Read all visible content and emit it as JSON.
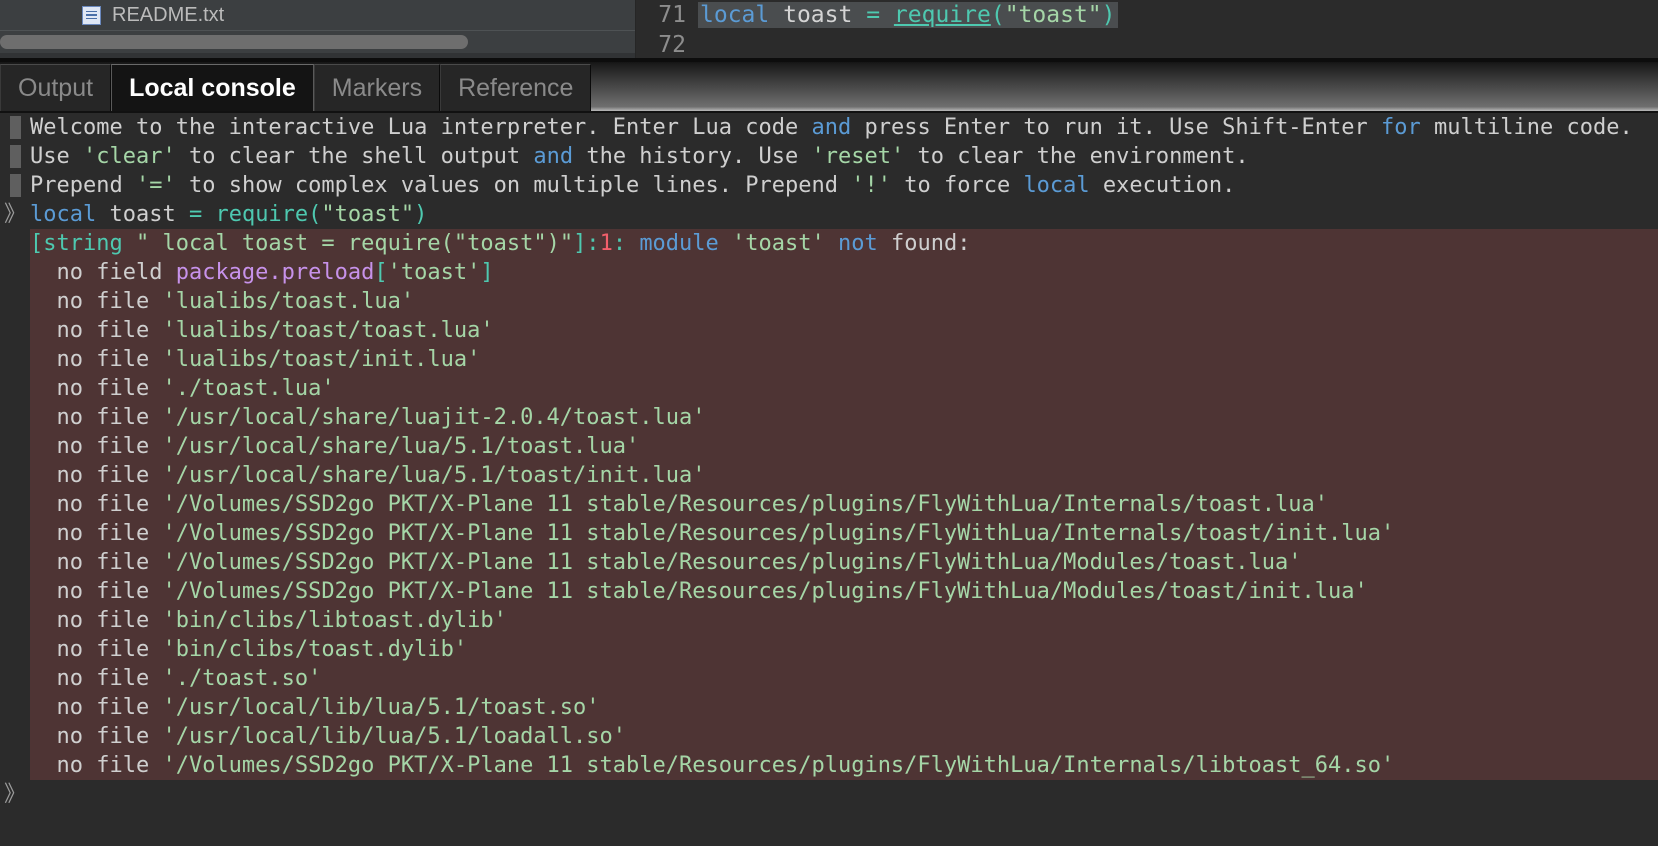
{
  "file_tree": {
    "items": [
      {
        "icon": "text-file-icon",
        "label": "README.txt"
      }
    ],
    "scrollbar": "horizontal-scrollbar"
  },
  "editor": {
    "lines": [
      {
        "number": "71",
        "highlighted": true,
        "tokens": [
          {
            "text": "local",
            "cls": "kw"
          },
          {
            "text": " toast ",
            "cls": "id"
          },
          {
            "text": "=",
            "cls": "op"
          },
          {
            "text": " ",
            "cls": "id"
          },
          {
            "text": "require",
            "cls": "fn"
          },
          {
            "text": "(",
            "cls": "op"
          },
          {
            "text": "\"toast\"",
            "cls": "str"
          },
          {
            "text": ")",
            "cls": "op"
          }
        ]
      },
      {
        "number": "72",
        "highlighted": false,
        "tokens": []
      }
    ]
  },
  "tabs": [
    {
      "label": "Output",
      "active": false
    },
    {
      "label": "Local console",
      "active": true
    },
    {
      "label": "Markers",
      "active": false
    },
    {
      "label": "Reference",
      "active": false
    }
  ],
  "console": {
    "welcome_lines": [
      {
        "marker": "block",
        "tokens": [
          {
            "text": "Welcome to the interactive Lua interpreter. Enter Lua code ",
            "cls": "t-grey"
          },
          {
            "text": "and",
            "cls": "t-blue"
          },
          {
            "text": " press Enter to run it. Use Shift-Enter ",
            "cls": "t-grey"
          },
          {
            "text": "for",
            "cls": "t-blue"
          },
          {
            "text": " multiline code.",
            "cls": "t-grey"
          }
        ]
      },
      {
        "marker": "block",
        "tokens": [
          {
            "text": "Use ",
            "cls": "t-grey"
          },
          {
            "text": "'clear'",
            "cls": "t-green"
          },
          {
            "text": " to clear the shell output ",
            "cls": "t-grey"
          },
          {
            "text": "and",
            "cls": "t-blue"
          },
          {
            "text": " the history. Use ",
            "cls": "t-grey"
          },
          {
            "text": "'reset'",
            "cls": "t-green"
          },
          {
            "text": " to clear the environment.",
            "cls": "t-grey"
          }
        ]
      },
      {
        "marker": "block",
        "tokens": [
          {
            "text": "Prepend ",
            "cls": "t-grey"
          },
          {
            "text": "'='",
            "cls": "t-green"
          },
          {
            "text": " to show complex values on multiple lines. Prepend ",
            "cls": "t-grey"
          },
          {
            "text": "'!'",
            "cls": "t-green"
          },
          {
            "text": " to force ",
            "cls": "t-grey"
          },
          {
            "text": "local",
            "cls": "t-blue"
          },
          {
            "text": " execution.",
            "cls": "t-grey"
          }
        ]
      },
      {
        "marker": "prompt",
        "tokens": [
          {
            "text": "local",
            "cls": "t-blue"
          },
          {
            "text": " toast ",
            "cls": "t-grey"
          },
          {
            "text": "=",
            "cls": "t-teal"
          },
          {
            "text": " ",
            "cls": "t-grey"
          },
          {
            "text": "require",
            "cls": "t-teal"
          },
          {
            "text": "(",
            "cls": "t-teal"
          },
          {
            "text": "\"toast\"",
            "cls": "t-green"
          },
          {
            "text": ")",
            "cls": "t-teal"
          }
        ]
      }
    ],
    "error_lines": [
      {
        "tokens": [
          {
            "text": "[string",
            "cls": "t-teal"
          },
          {
            "text": " ",
            "cls": "t-grey"
          },
          {
            "text": "\" local toast = require(\"toast\")\"",
            "cls": "t-green"
          },
          {
            "text": "]:",
            "cls": "t-teal"
          },
          {
            "text": "1",
            "cls": "t-red"
          },
          {
            "text": ": ",
            "cls": "t-teal"
          },
          {
            "text": "module",
            "cls": "t-blue"
          },
          {
            "text": " ",
            "cls": "t-grey"
          },
          {
            "text": "'toast'",
            "cls": "t-green"
          },
          {
            "text": " ",
            "cls": "t-grey"
          },
          {
            "text": "not",
            "cls": "t-blue"
          },
          {
            "text": " found:",
            "cls": "t-grey"
          }
        ]
      },
      {
        "tokens": [
          {
            "text": "  no field ",
            "cls": "t-grey"
          },
          {
            "text": "package.preload",
            "cls": "t-mag"
          },
          {
            "text": "[",
            "cls": "t-teal"
          },
          {
            "text": "'toast'",
            "cls": "t-green"
          },
          {
            "text": "]",
            "cls": "t-teal"
          }
        ]
      },
      {
        "tokens": [
          {
            "text": "  no file ",
            "cls": "t-grey"
          },
          {
            "text": "'lualibs/toast.lua'",
            "cls": "t-green"
          }
        ]
      },
      {
        "tokens": [
          {
            "text": "  no file ",
            "cls": "t-grey"
          },
          {
            "text": "'lualibs/toast/toast.lua'",
            "cls": "t-green"
          }
        ]
      },
      {
        "tokens": [
          {
            "text": "  no file ",
            "cls": "t-grey"
          },
          {
            "text": "'lualibs/toast/init.lua'",
            "cls": "t-green"
          }
        ]
      },
      {
        "tokens": [
          {
            "text": "  no file ",
            "cls": "t-grey"
          },
          {
            "text": "'./toast.lua'",
            "cls": "t-green"
          }
        ]
      },
      {
        "tokens": [
          {
            "text": "  no file ",
            "cls": "t-grey"
          },
          {
            "text": "'/usr/local/share/luajit-2.0.4/toast.lua'",
            "cls": "t-green"
          }
        ]
      },
      {
        "tokens": [
          {
            "text": "  no file ",
            "cls": "t-grey"
          },
          {
            "text": "'/usr/local/share/lua/5.1/toast.lua'",
            "cls": "t-green"
          }
        ]
      },
      {
        "tokens": [
          {
            "text": "  no file ",
            "cls": "t-grey"
          },
          {
            "text": "'/usr/local/share/lua/5.1/toast/init.lua'",
            "cls": "t-green"
          }
        ]
      },
      {
        "tokens": [
          {
            "text": "  no file ",
            "cls": "t-grey"
          },
          {
            "text": "'/Volumes/SSD2go PKT/X-Plane 11 stable/Resources/plugins/FlyWithLua/Internals/toast.lua'",
            "cls": "t-green"
          }
        ]
      },
      {
        "tokens": [
          {
            "text": "  no file ",
            "cls": "t-grey"
          },
          {
            "text": "'/Volumes/SSD2go PKT/X-Plane 11 stable/Resources/plugins/FlyWithLua/Internals/toast/init.lua'",
            "cls": "t-green"
          }
        ]
      },
      {
        "tokens": [
          {
            "text": "  no file ",
            "cls": "t-grey"
          },
          {
            "text": "'/Volumes/SSD2go PKT/X-Plane 11 stable/Resources/plugins/FlyWithLua/Modules/toast.lua'",
            "cls": "t-green"
          }
        ]
      },
      {
        "tokens": [
          {
            "text": "  no file ",
            "cls": "t-grey"
          },
          {
            "text": "'/Volumes/SSD2go PKT/X-Plane 11 stable/Resources/plugins/FlyWithLua/Modules/toast/init.lua'",
            "cls": "t-green"
          }
        ]
      },
      {
        "tokens": [
          {
            "text": "  no file ",
            "cls": "t-grey"
          },
          {
            "text": "'bin/clibs/libtoast.dylib'",
            "cls": "t-green"
          }
        ]
      },
      {
        "tokens": [
          {
            "text": "  no file ",
            "cls": "t-grey"
          },
          {
            "text": "'bin/clibs/toast.dylib'",
            "cls": "t-green"
          }
        ]
      },
      {
        "tokens": [
          {
            "text": "  no file ",
            "cls": "t-grey"
          },
          {
            "text": "'./toast.so'",
            "cls": "t-green"
          }
        ]
      },
      {
        "tokens": [
          {
            "text": "  no file ",
            "cls": "t-grey"
          },
          {
            "text": "'/usr/local/lib/lua/5.1/toast.so'",
            "cls": "t-green"
          }
        ]
      },
      {
        "tokens": [
          {
            "text": "  no file ",
            "cls": "t-grey"
          },
          {
            "text": "'/usr/local/lib/lua/5.1/loadall.so'",
            "cls": "t-green"
          }
        ]
      },
      {
        "tokens": [
          {
            "text": "  no file ",
            "cls": "t-grey"
          },
          {
            "text": "'/Volumes/SSD2go PKT/X-Plane 11 stable/Resources/plugins/FlyWithLua/Internals/libtoast_64.so'",
            "cls": "t-green"
          }
        ]
      }
    ],
    "input_prompt": "》",
    "prompt_glyph": "》"
  },
  "colors": {
    "background": "#2b2b2b",
    "error_background": "#4e3434",
    "keyword": "#5b9bd5",
    "string": "#a5d6a7",
    "operator": "#4ec9b0",
    "number": "#f25f6b",
    "magenta": "#c792ea",
    "text": "#cfcfcf"
  }
}
